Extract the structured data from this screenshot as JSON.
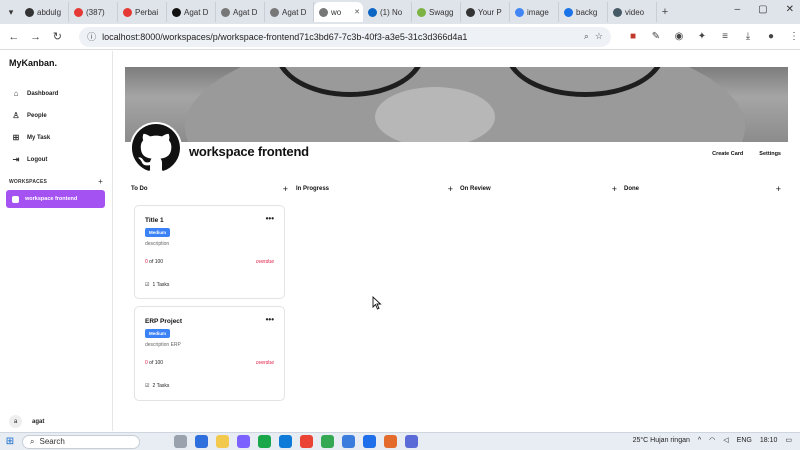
{
  "browser": {
    "tabs": [
      {
        "label": "abdulg",
        "color": "#333333"
      },
      {
        "label": "(387) ",
        "color": "#e53935"
      },
      {
        "label": "Perbai",
        "color": "#e53935"
      },
      {
        "label": "Agat D",
        "color": "#111111"
      },
      {
        "label": "Agat D",
        "color": "#777777"
      },
      {
        "label": "Agat D",
        "color": "#777777"
      },
      {
        "label": "wo",
        "color": "#777777",
        "active": true
      },
      {
        "label": "(1) No",
        "color": "#0a66c2"
      },
      {
        "label": "Swagg",
        "color": "#7cb342"
      },
      {
        "label": "Your P",
        "color": "#333333"
      },
      {
        "label": "image",
        "color": "#4285f4"
      },
      {
        "label": "backg",
        "color": "#1a73e8"
      },
      {
        "label": "video",
        "color": "#455a64"
      }
    ],
    "new_tab_label": "+",
    "url": "localhost:8000/workspaces/p/workspace-frontend71c3bd67-7c3b-40f3-a3e5-31c3d366d4a1"
  },
  "app": {
    "brand": "MyKanban.",
    "nav": [
      {
        "label": "Dashboard",
        "icon": "home-icon"
      },
      {
        "label": "People",
        "icon": "person-icon"
      },
      {
        "label": "My Task",
        "icon": "grid-icon"
      },
      {
        "label": "Logout",
        "icon": "logout-icon"
      }
    ],
    "workspaces_heading": "WORKSPACES",
    "workspaces_add": "+",
    "workspaces": [
      {
        "label": "workspace frontend",
        "color": "#a552f2"
      }
    ],
    "user": {
      "initial": "a",
      "name": "agat"
    }
  },
  "workspace": {
    "title": "workspace frontend",
    "actions": {
      "create_card": "Create Card",
      "settings": "Settings"
    },
    "columns": [
      {
        "name": "To Do",
        "add": "+"
      },
      {
        "name": "In Progress",
        "add": "+"
      },
      {
        "name": "On Review",
        "add": "+"
      },
      {
        "name": "Done",
        "add": "+"
      }
    ],
    "cards": [
      {
        "title": "Title 1",
        "priority": "Medium",
        "description": "description",
        "done": "0",
        "total": " of 100",
        "status": "overdue",
        "tasks": "1 Tasks",
        "menu": "•••"
      },
      {
        "title": "ERP Project",
        "priority": "Medium",
        "description": "description ERP",
        "done": "0",
        "total": " of 100",
        "status": "overdue",
        "tasks": "2 Tasks",
        "menu": "•••"
      }
    ]
  },
  "taskbar": {
    "search_label": "Search",
    "weather": "25°C  Hujan ringan",
    "language": "ENG",
    "time": "18:10"
  },
  "colors": {
    "accent": "#a552f2",
    "badge": "#3b82f6",
    "danger": "#e11d48"
  }
}
